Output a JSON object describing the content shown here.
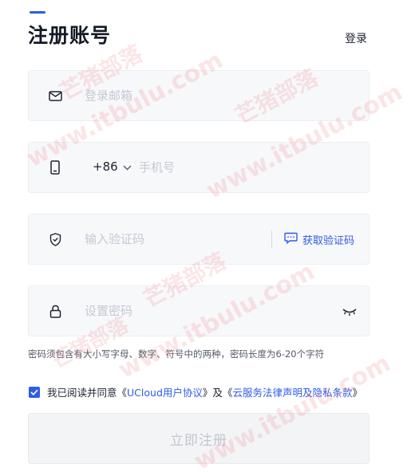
{
  "header": {
    "title": "注册账号",
    "login_link": "登录"
  },
  "email_field": {
    "placeholder": "登录邮箱",
    "icon": "mail-icon"
  },
  "phone_field": {
    "country_code": "+86",
    "placeholder": "手机号",
    "icon": "phone-icon"
  },
  "code_field": {
    "placeholder": "输入验证码",
    "get_code_label": "获取验证码",
    "icon": "shield-check-icon"
  },
  "password_field": {
    "placeholder": "设置密码",
    "icon": "lock-icon",
    "toggle_icon": "eye-closed-icon"
  },
  "password_hint": "密码须包含有大小写字母、数字、符号中的两种，密码长度为6-20个字符",
  "agreement": {
    "checked": true,
    "prefix": "我已阅读并同意",
    "open_quote_1": "《",
    "link_1": "UCloud用户协议",
    "close_quote_1": "》",
    "conjunction": "及",
    "open_quote_2": "《",
    "link_2": "云服务法律声明及隐私条款",
    "close_quote_2": "》"
  },
  "submit_label": "立即注册",
  "watermark": {
    "text_cn": "芒猪部落",
    "text_url": "www.itbulu.com"
  },
  "colors": {
    "accent": "#2f5bea",
    "title": "#151a28",
    "field_bg": "#f7f8fa",
    "watermark": "#ec7078"
  }
}
